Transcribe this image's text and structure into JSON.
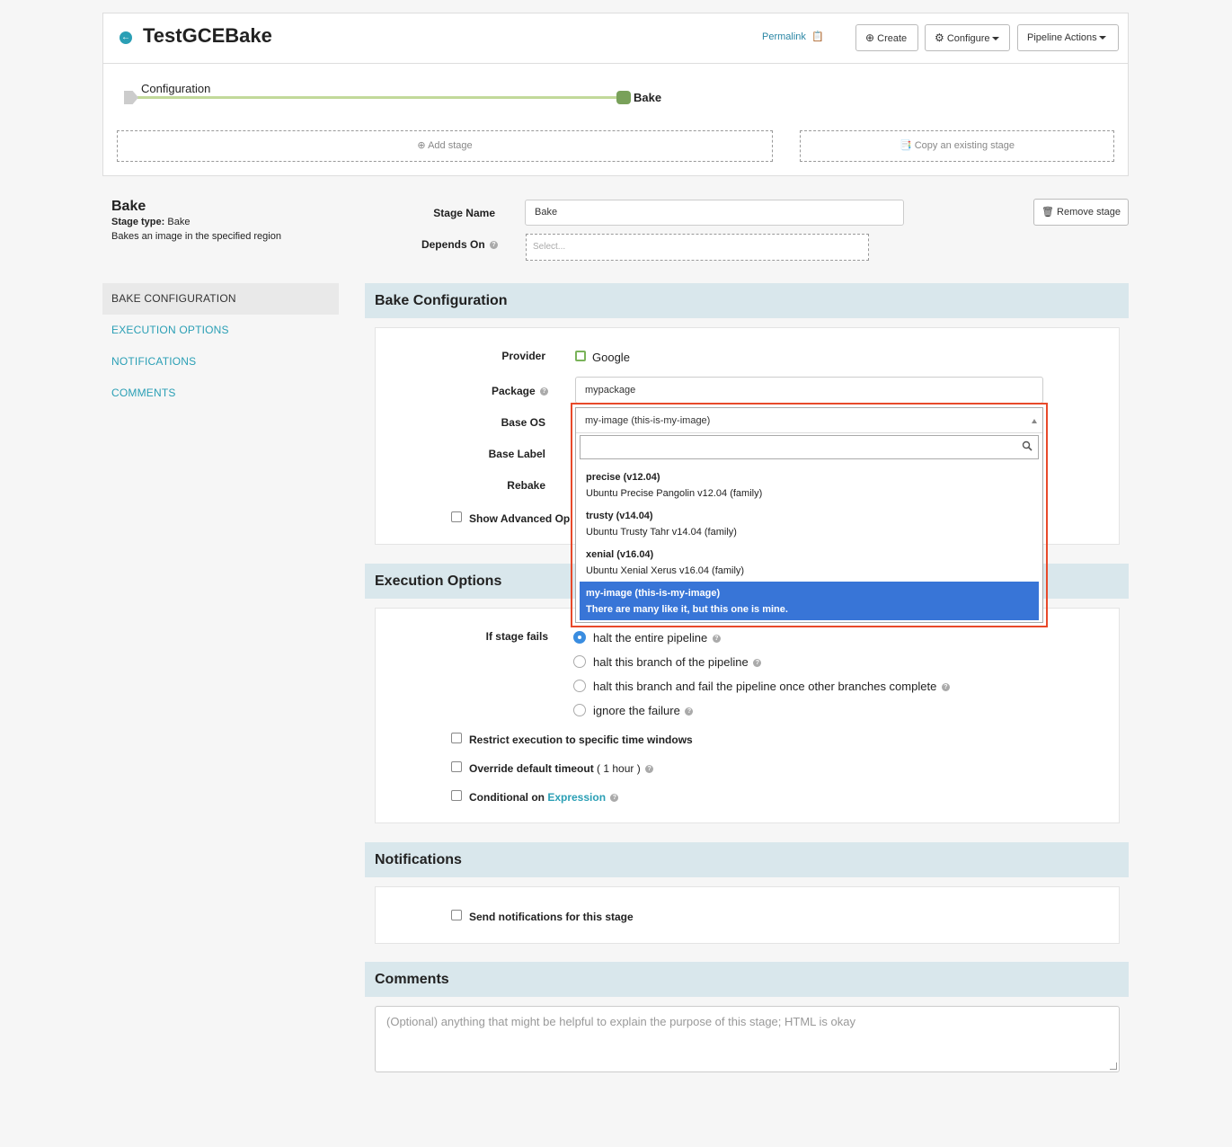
{
  "header": {
    "title": "TestGCEBake",
    "permalink": "Permalink",
    "create_label": "Create",
    "configure_label": "Configure",
    "actions_label": "Pipeline Actions"
  },
  "graph": {
    "start_label": "Configuration",
    "end_label": "Bake",
    "add_stage": "Add stage",
    "copy_stage": "Copy an existing stage"
  },
  "stage": {
    "name": "Bake",
    "type_label": "Stage type:",
    "type_value": "Bake",
    "description": "Bakes an image in the specified region",
    "name_label": "Stage Name",
    "name_value": "Bake",
    "depends_label": "Depends On",
    "depends_placeholder": "Select...",
    "remove_label": "Remove stage"
  },
  "nav": {
    "items": [
      {
        "label": "BAKE CONFIGURATION"
      },
      {
        "label": "EXECUTION OPTIONS"
      },
      {
        "label": "NOTIFICATIONS"
      },
      {
        "label": "COMMENTS"
      }
    ]
  },
  "bake": {
    "title": "Bake Configuration",
    "provider_label": "Provider",
    "provider_value": "Google",
    "package_label": "Package",
    "package_value": "mypackage",
    "base_os_label": "Base OS",
    "base_label_label": "Base Label",
    "rebake_label": "Rebake",
    "show_advanced_label": "Show Advanced Op"
  },
  "dropdown": {
    "selected": "my-image (this-is-my-image)",
    "search_value": "",
    "options": [
      {
        "title": "precise (v12.04)",
        "subtitle": "Ubuntu Precise Pangolin v12.04 (family)"
      },
      {
        "title": "trusty (v14.04)",
        "subtitle": "Ubuntu Trusty Tahr v14.04 (family)"
      },
      {
        "title": "xenial (v16.04)",
        "subtitle": "Ubuntu Xenial Xerus v16.04 (family)"
      },
      {
        "title": "my-image (this-is-my-image)",
        "subtitle": "There are many like it, but this one is mine."
      }
    ],
    "selected_index": 3
  },
  "execution": {
    "title": "Execution Options",
    "fail_label": "If stage fails",
    "options": [
      {
        "label": "halt the entire pipeline"
      },
      {
        "label": "halt this branch of the pipeline"
      },
      {
        "label": "halt this branch and fail the pipeline once other branches complete"
      },
      {
        "label": "ignore the failure"
      }
    ],
    "restrict_label": "Restrict execution to specific time windows",
    "override_label": "Override default timeout",
    "override_value": "( 1 hour )",
    "conditional_label": "Conditional on",
    "conditional_link": "Expression"
  },
  "notifications": {
    "title": "Notifications",
    "send_label": "Send notifications for this stage"
  },
  "comments": {
    "title": "Comments",
    "placeholder": "(Optional) anything that might be helpful to explain the purpose of this stage; HTML is okay"
  },
  "colors": {
    "accent": "#2a9fb5",
    "section_header": "#d9e7ec",
    "dropdown_selected": "#3875d7",
    "highlight_border": "#e8492a"
  }
}
